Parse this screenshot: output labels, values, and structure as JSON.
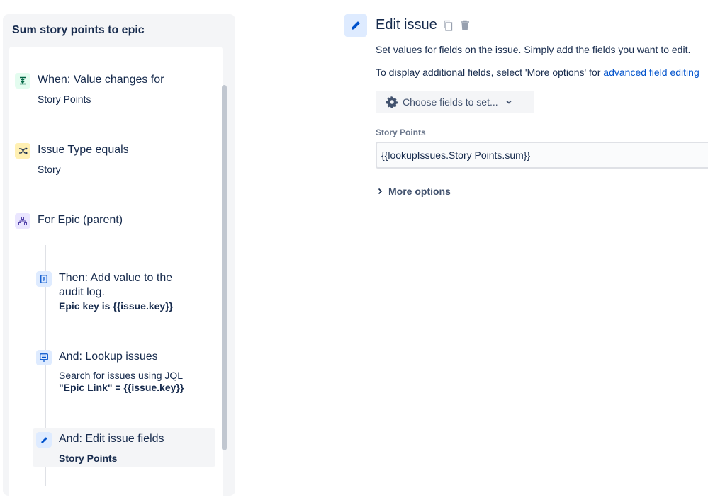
{
  "rule": {
    "title": "Sum story points to epic",
    "components": [
      {
        "kind": "trigger",
        "icon": "trigger-icon",
        "title": "When: Value changes for",
        "subtitle": "Story Points"
      },
      {
        "kind": "condition",
        "icon": "condition-shuffle-icon",
        "title": "Issue Type equals",
        "subtitle": "Story"
      },
      {
        "kind": "branch",
        "icon": "branch-hierarchy-icon",
        "title": "For Epic (parent)"
      },
      {
        "kind": "action",
        "icon": "audit-log-icon",
        "title_line1": "Then: Add value to the",
        "title_line2": "audit log.",
        "bold": "Epic key is {{issue.key}}"
      },
      {
        "kind": "action",
        "icon": "lookup-issues-icon",
        "title": "And: Lookup issues",
        "subtitle": "Search for issues using JQL",
        "bold": "\"Epic Link\" = {{issue.key}}"
      },
      {
        "kind": "action",
        "icon": "edit-pencil-icon",
        "title": "And: Edit issue fields",
        "bold": "Story Points",
        "selected": true
      }
    ]
  },
  "editor": {
    "title": "Edit issue",
    "description": "Set values for fields on the issue. Simply add the fields you want to edit.",
    "more_text": "To display additional fields, select 'More options' for ",
    "advanced_link": "advanced field editing",
    "choose_fields_label": "Choose fields to set...",
    "field_label": "Story Points",
    "field_value": "{{lookupIssues.Story Points.sum}}",
    "more_options_label": "More options"
  },
  "colors": {
    "accent": "#0052cc",
    "text": "#172b4d",
    "panel_bg": "#f4f5f7",
    "trigger_bg": "#e3fcef",
    "condition_bg": "#fff0b3",
    "branch_bg": "#eae6ff",
    "action_bg": "#deebff"
  }
}
